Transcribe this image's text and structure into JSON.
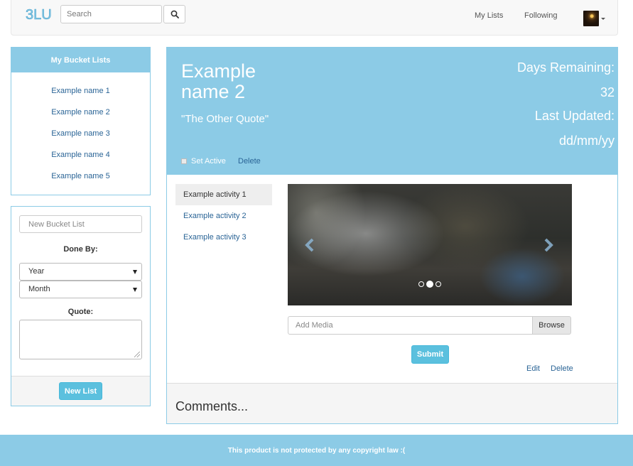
{
  "navbar": {
    "brand": "3LU",
    "search_placeholder": "Search",
    "links": {
      "my_lists": "My Lists",
      "following": "Following"
    }
  },
  "sidebar": {
    "header": "My Bucket Lists",
    "items": [
      {
        "label": "Example name 1"
      },
      {
        "label": "Example name 2"
      },
      {
        "label": "Example name 3"
      },
      {
        "label": "Example name 4"
      },
      {
        "label": "Example name 5"
      }
    ]
  },
  "new_list_form": {
    "name_placeholder": "New Bucket List",
    "done_by_label": "Done By:",
    "year_value": "Year",
    "month_value": "Month",
    "quote_label": "Quote:",
    "submit_label": "New List"
  },
  "list_detail": {
    "title": "Example name 2",
    "quote": "\"The Other Quote\"",
    "days_remaining_label": "Days Remaining:",
    "days_remaining_value": "32",
    "last_updated_label": "Last Updated:",
    "last_updated_value": "dd/mm/yy",
    "set_active_label": "Set Active",
    "delete_label": "Delete"
  },
  "activities": [
    {
      "label": "Example activity 1",
      "active": true
    },
    {
      "label": "Example activity 2",
      "active": false
    },
    {
      "label": "Example activity 3",
      "active": false
    }
  ],
  "carousel": {
    "slide_count": 3,
    "active_index": 1
  },
  "media": {
    "placeholder": "Add Media",
    "browse_label": "Browse",
    "submit_label": "Submit",
    "edit_label": "Edit",
    "delete_label": "Delete"
  },
  "comments": {
    "title": "Comments..."
  },
  "footer": {
    "text": "This product is not protected by any copyright law :("
  },
  "colors": {
    "accent": "#8ccbe6",
    "button": "#5bc0de",
    "link": "#2a6496"
  }
}
